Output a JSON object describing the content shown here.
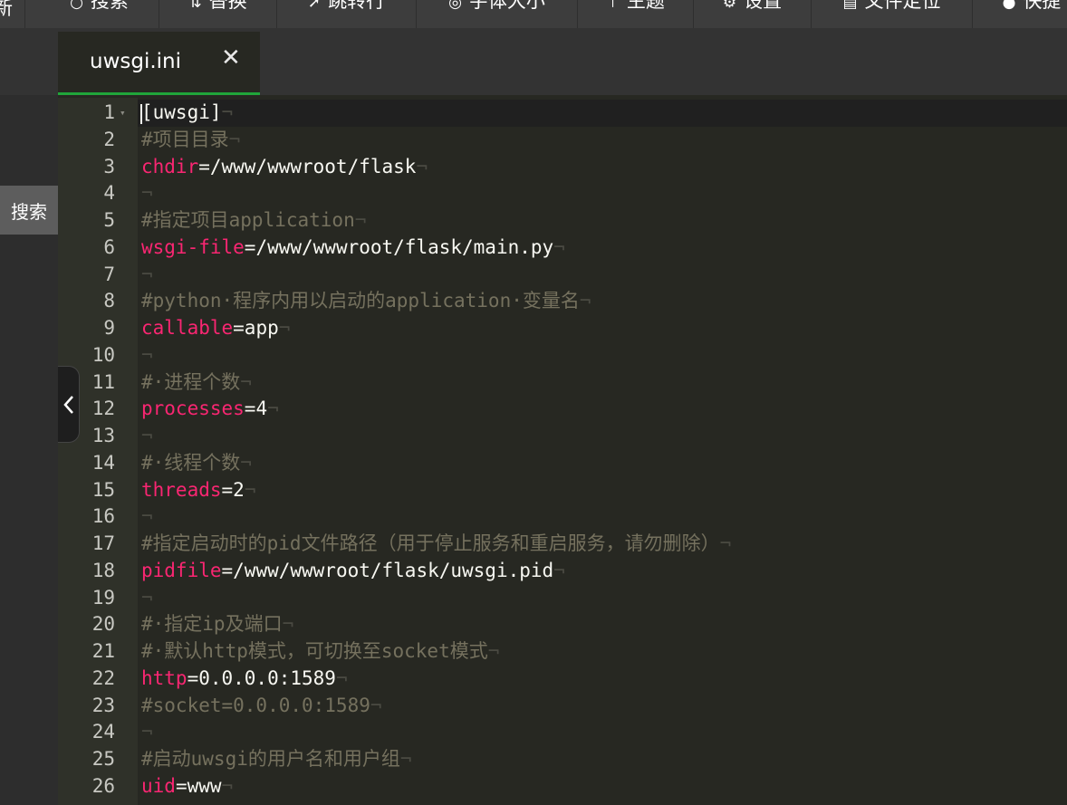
{
  "toolbar": {
    "items": [
      {
        "label": "新",
        "icon": ""
      },
      {
        "label": "搜索",
        "icon": "search-icon"
      },
      {
        "label": "替换",
        "icon": "replace-icon"
      },
      {
        "label": "跳转行",
        "icon": "jump-icon"
      },
      {
        "label": "字体大小",
        "icon": "font-icon"
      },
      {
        "label": "主题",
        "icon": "theme-icon"
      },
      {
        "label": "设置",
        "icon": "gear-icon"
      },
      {
        "label": "文件定位",
        "icon": "file-icon"
      },
      {
        "label": "快捷",
        "icon": "help-icon"
      }
    ]
  },
  "tab": {
    "title": "uwsgi.ini",
    "close": "✕"
  },
  "side": {
    "search_label": "搜索",
    "collapse": "‹"
  },
  "colors": {
    "keyword": "#f92672",
    "comment": "#75715e",
    "text": "#f8f8f2",
    "background": "#272822",
    "accent": "#20a53a"
  },
  "editor": {
    "invisible": "¬",
    "lines": [
      {
        "num": "1",
        "kind": "plain",
        "text": "[uwsgi]"
      },
      {
        "num": "2",
        "kind": "comment",
        "text": "#项目目录"
      },
      {
        "num": "3",
        "kind": "kv",
        "key": "chdir",
        "val": "=/www/wwwroot/flask"
      },
      {
        "num": "4",
        "kind": "empty",
        "text": ""
      },
      {
        "num": "5",
        "kind": "comment",
        "text": "#指定项目application"
      },
      {
        "num": "6",
        "kind": "kv",
        "key": "wsgi-file",
        "val": "=/www/wwwroot/flask/main.py"
      },
      {
        "num": "7",
        "kind": "empty",
        "text": ""
      },
      {
        "num": "8",
        "kind": "comment",
        "text": "#python·程序内用以启动的application·变量名"
      },
      {
        "num": "9",
        "kind": "kv",
        "key": "callable",
        "val": "=app"
      },
      {
        "num": "10",
        "kind": "empty",
        "text": ""
      },
      {
        "num": "11",
        "kind": "comment",
        "text": "#·进程个数"
      },
      {
        "num": "12",
        "kind": "kv",
        "key": "processes",
        "val": "=4"
      },
      {
        "num": "13",
        "kind": "empty",
        "text": ""
      },
      {
        "num": "14",
        "kind": "comment",
        "text": "#·线程个数"
      },
      {
        "num": "15",
        "kind": "kv",
        "key": "threads",
        "val": "=2"
      },
      {
        "num": "16",
        "kind": "empty",
        "text": ""
      },
      {
        "num": "17",
        "kind": "comment",
        "text": "#指定启动时的pid文件路径（用于停止服务和重启服务，请勿删除）"
      },
      {
        "num": "18",
        "kind": "kv",
        "key": "pidfile",
        "val": "=/www/wwwroot/flask/uwsgi.pid"
      },
      {
        "num": "19",
        "kind": "empty",
        "text": ""
      },
      {
        "num": "20",
        "kind": "comment",
        "text": "#·指定ip及端口"
      },
      {
        "num": "21",
        "kind": "comment",
        "text": "#·默认http模式，可切换至socket模式"
      },
      {
        "num": "22",
        "kind": "kv",
        "key": "http",
        "val": "=0.0.0.0:1589"
      },
      {
        "num": "23",
        "kind": "comment",
        "text": "#socket=0.0.0.0:1589"
      },
      {
        "num": "24",
        "kind": "empty",
        "text": ""
      },
      {
        "num": "25",
        "kind": "comment",
        "text": "#启动uwsgi的用户名和用户组"
      },
      {
        "num": "26",
        "kind": "kv",
        "key": "uid",
        "val": "=www"
      }
    ]
  }
}
